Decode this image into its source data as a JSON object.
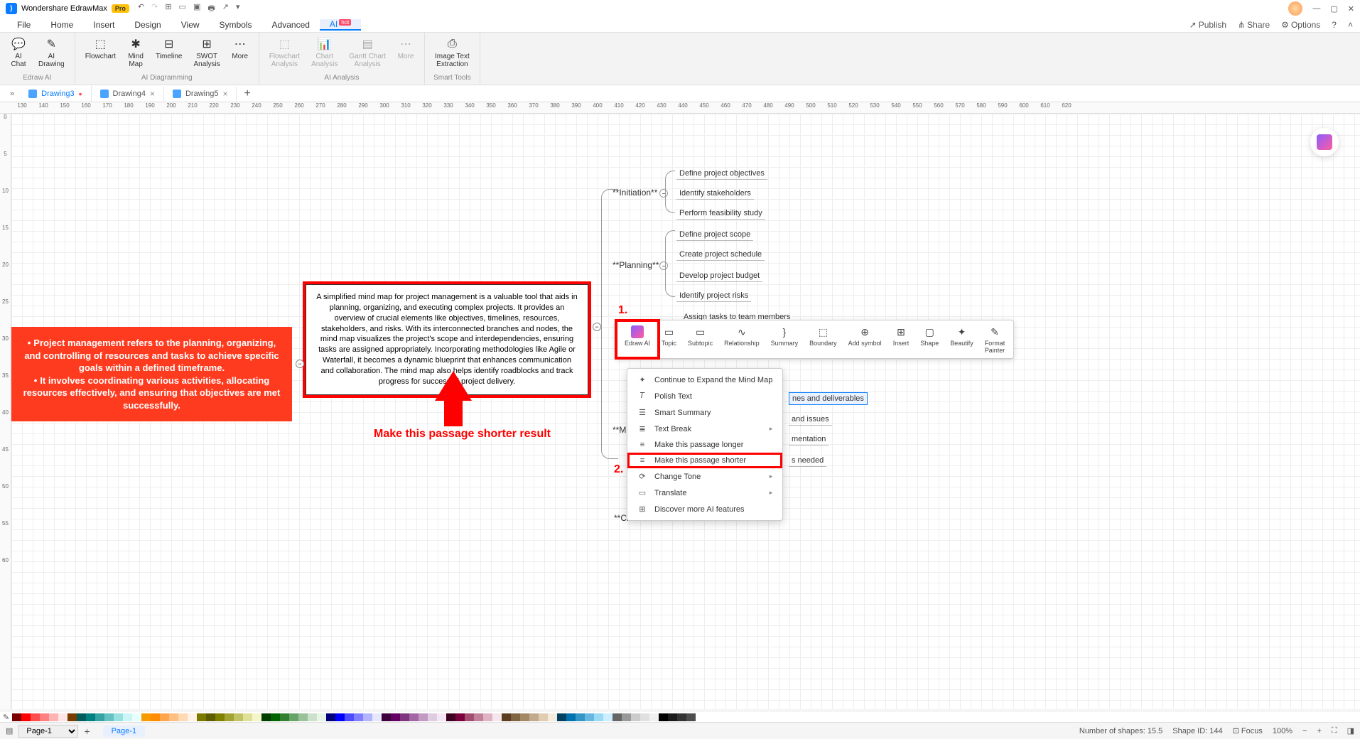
{
  "title": "Wondershare EdrawMax",
  "badge": "Pro",
  "menubar": [
    "File",
    "Home",
    "Insert",
    "Design",
    "View",
    "Symbols",
    "Advanced"
  ],
  "menubar_ai": "AI",
  "menubar_ai_badge": "hot",
  "menubar_right": [
    "Publish",
    "Share",
    "Options"
  ],
  "ribbon": {
    "g1": {
      "items": [
        "AI\nChat",
        "AI\nDrawing"
      ],
      "label": "Edraw AI"
    },
    "g2": {
      "items": [
        "Flowchart",
        "Mind\nMap",
        "Timeline",
        "SWOT\nAnalysis",
        "More"
      ],
      "label": "AI Diagramming"
    },
    "g3": {
      "items": [
        "Flowchart\nAnalysis",
        "Chart\nAnalysis",
        "Gantt Chart\nAnalysis",
        "More"
      ],
      "label": "AI Analysis"
    },
    "g4": {
      "items": [
        "Image Text\nExtraction"
      ],
      "label": "Smart Tools"
    }
  },
  "doctabs": [
    {
      "name": "Drawing3",
      "active": true,
      "dirty": true
    },
    {
      "name": "Drawing4",
      "active": false,
      "dirty": false
    },
    {
      "name": "Drawing5",
      "active": false,
      "dirty": false
    }
  ],
  "ruler_start": 130,
  "node_red_lines": [
    "Project management refers to the planning, organizing, and controlling of resources and tasks to achieve specific goals within a defined timeframe.",
    "It involves coordinating various activities, allocating resources effectively, and ensuring that objectives are met successfully."
  ],
  "node_box": "A simplified mind map for project management is a valuable tool that aids in planning, organizing, and executing complex projects. It provides an overview of crucial elements like objectives, timelines, resources, stakeholders, and risks. With its interconnected branches and nodes, the mind map visualizes the project's scope and interdependencies, ensuring tasks are assigned appropriately. Incorporating methodologies like Agile or Waterfall, it becomes a dynamic blueprint that enhances communication and collaboration. The mind map also helps identify roadblocks and track progress for successful project delivery.",
  "arrow_label": "Make this passage shorter result",
  "mindmap": {
    "branches": {
      "initiation": {
        "label": "**Initiation**",
        "leaves": [
          "Define project objectives",
          "Identify stakeholders",
          "Perform feasibility study"
        ]
      },
      "planning": {
        "label": "**Planning**",
        "leaves": [
          "Define project scope",
          "Create project schedule",
          "Develop project budget",
          "Identify project risks"
        ]
      },
      "execution": {
        "leaves": [
          "Assign tasks to team members"
        ]
      },
      "partial1": "nes and deliverables",
      "partial2": "and issues",
      "partial3": "mentation",
      "partial4": "s needed",
      "m_label": "**M",
      "cl_label": "**Cl"
    }
  },
  "floatbar": [
    "Edraw AI",
    "Topic",
    "Subtopic",
    "Relationship",
    "Summary",
    "Boundary",
    "Add symbol",
    "Insert",
    "Shape",
    "Beautify",
    "Format\nPainter"
  ],
  "dropdown": [
    {
      "label": "Continue to Expand the Mind Map",
      "icon": "✦"
    },
    {
      "label": "Polish Text",
      "icon": "𝑇"
    },
    {
      "label": "Smart Summary",
      "icon": "☰"
    },
    {
      "label": "Text Break",
      "icon": "≣",
      "sub": true
    },
    {
      "label": "Make this passage longer",
      "icon": "≡"
    },
    {
      "label": "Make this passage shorter",
      "icon": "≡",
      "highlight": true
    },
    {
      "label": "Change Tone",
      "icon": "⟳",
      "sub": true
    },
    {
      "label": "Translate",
      "icon": "▭",
      "sub": true
    },
    {
      "label": "Discover more AI features",
      "icon": "⊞"
    }
  ],
  "step1": "1.",
  "step2": "2.",
  "status": {
    "page_sel": "Page-1",
    "page_tab": "Page-1",
    "shapes": "Number of shapes: 15.5",
    "shapeid": "Shape ID: 144",
    "focus": "Focus",
    "zoom": "100%"
  },
  "colors": [
    "#7a0000",
    "#ff0000",
    "#ff4d4d",
    "#ff8080",
    "#ffb3b3",
    "#ffe6e6",
    "#7a3d00",
    "#005c5c",
    "#008080",
    "#33a3a3",
    "#66c2c2",
    "#99e0e0",
    "#ccf5f5",
    "#e6ffff",
    "#f79b00",
    "#ff8c00",
    "#ffa64d",
    "#ffbf80",
    "#ffd9b3",
    "#fff2e6",
    "#7a7a00",
    "#5c5c00",
    "#808000",
    "#a3a333",
    "#c2c266",
    "#e0e099",
    "#f5f5cc",
    "#003d00",
    "#006400",
    "#338033",
    "#66a366",
    "#99c299",
    "#cce0cc",
    "#e6f5e6",
    "#00007a",
    "#0000ff",
    "#4d4dff",
    "#8080ff",
    "#b3b3ff",
    "#e6e6ff",
    "#3d003d",
    "#640064",
    "#803380",
    "#a366a3",
    "#c299c2",
    "#e0cce0",
    "#f5e6f5",
    "#3d0020",
    "#7a003d",
    "#a34d70",
    "#c28099",
    "#e0b3c2",
    "#f5e6ee",
    "#5c3d1f",
    "#806640",
    "#a38866",
    "#c2aa8c",
    "#e0ccb3",
    "#f5ebdc",
    "#004060",
    "#0073ae",
    "#3396c7",
    "#66b8e0",
    "#99daf5",
    "#cceeff",
    "#666666",
    "#999999",
    "#cccccc",
    "#e0e0e0",
    "#f0f0f0",
    "#000000",
    "#1a1a1a",
    "#333333",
    "#4d4d4d",
    "#ffffff"
  ]
}
